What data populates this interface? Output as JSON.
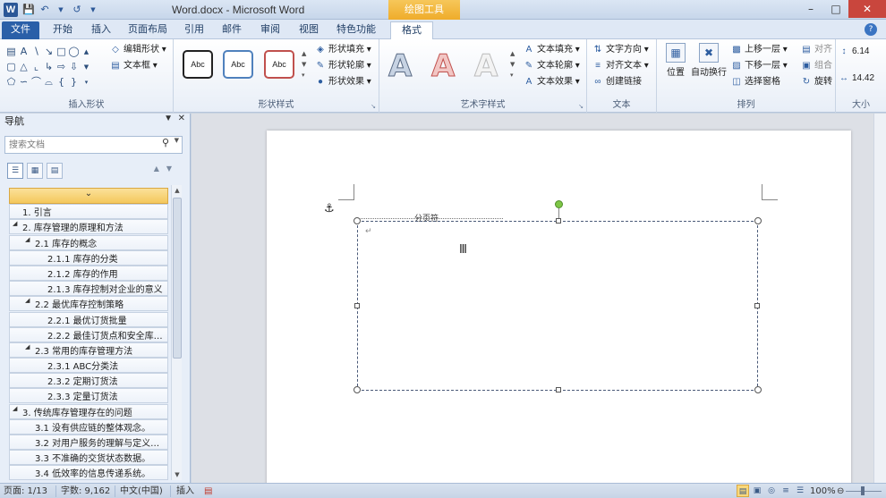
{
  "app": {
    "title": "Word.docx - Microsoft Word",
    "tools_tab": "绘图工具"
  },
  "qat": {
    "icons": [
      "save-icon",
      "undo-icon",
      "redo-icon"
    ]
  },
  "tabs": [
    {
      "label": "文件"
    },
    {
      "label": "开始"
    },
    {
      "label": "插入"
    },
    {
      "label": "页面布局"
    },
    {
      "label": "引用"
    },
    {
      "label": "邮件"
    },
    {
      "label": "审阅"
    },
    {
      "label": "视图"
    },
    {
      "label": "特色功能"
    },
    {
      "label": "格式"
    }
  ],
  "ribbon": {
    "insert_shapes": {
      "label": "插入形状",
      "edit_shape": "编辑形状",
      "text_box": "文本框"
    },
    "shape_styles": {
      "label": "形状样式",
      "preset": "Abc",
      "fill": "形状填充",
      "outline": "形状轮廓",
      "effects": "形状效果"
    },
    "wordart_styles": {
      "label": "艺术字样式",
      "glyph": "A",
      "text_fill": "文本填充",
      "text_outline": "文本轮廓",
      "text_effects": "文本效果"
    },
    "text": {
      "label": "文本",
      "direction": "文字方向",
      "align": "对齐文本",
      "link": "创建链接"
    },
    "arrange": {
      "label": "排列",
      "position": "位置",
      "wrap": "自动换行",
      "bring_forward": "上移一层",
      "send_backward": "下移一层",
      "selection_pane": "选择窗格",
      "rotate": "旋转",
      "combine": "组合",
      "align": "对齐"
    },
    "size": {
      "label": "大小",
      "height": "6.14",
      "width": "14.42"
    }
  },
  "nav": {
    "title": "导航",
    "search_placeholder": "搜索文档",
    "items": [
      {
        "text": "1. 引言",
        "level": 1
      },
      {
        "text": "2. 库存管理的原理和方法",
        "level": 1,
        "expanded": true
      },
      {
        "text": "2.1 库存的概念",
        "level": 2,
        "expanded": true
      },
      {
        "text": "2.1.1 库存的分类",
        "level": 3
      },
      {
        "text": "2.1.2 库存的作用",
        "level": 3
      },
      {
        "text": "2.1.3 库存控制对企业的意义",
        "level": 3
      },
      {
        "text": "2.2 最优库存控制策略",
        "level": 2,
        "expanded": true
      },
      {
        "text": "2.2.1 最优订货批量",
        "level": 3
      },
      {
        "text": "2.2.2 最佳订货点和安全库存...",
        "level": 3
      },
      {
        "text": "2.3 常用的库存管理方法",
        "level": 2,
        "expanded": true
      },
      {
        "text": "2.3.1 ABC分类法",
        "level": 3
      },
      {
        "text": "2.3.2 定期订货法",
        "level": 3
      },
      {
        "text": "2.3.3 定量订货法",
        "level": 3
      },
      {
        "text": "3. 传统库存管理存在的问题",
        "level": 1,
        "expanded": true
      },
      {
        "text": "3.1 没有供应链的整体观念。",
        "level": 2
      },
      {
        "text": "3.2 对用户服务的理解与定义不...",
        "level": 2
      },
      {
        "text": "3.3 不准确的交货状态数据。",
        "level": 2
      },
      {
        "text": "3.4 低效率的信息传递系统。",
        "level": 2
      }
    ]
  },
  "document": {
    "page_break": "分页符"
  },
  "status": {
    "page": "页面: 1/13",
    "words": "字数: 9,162",
    "language": "中文(中国)",
    "mode": "插入",
    "zoom": "100%"
  }
}
